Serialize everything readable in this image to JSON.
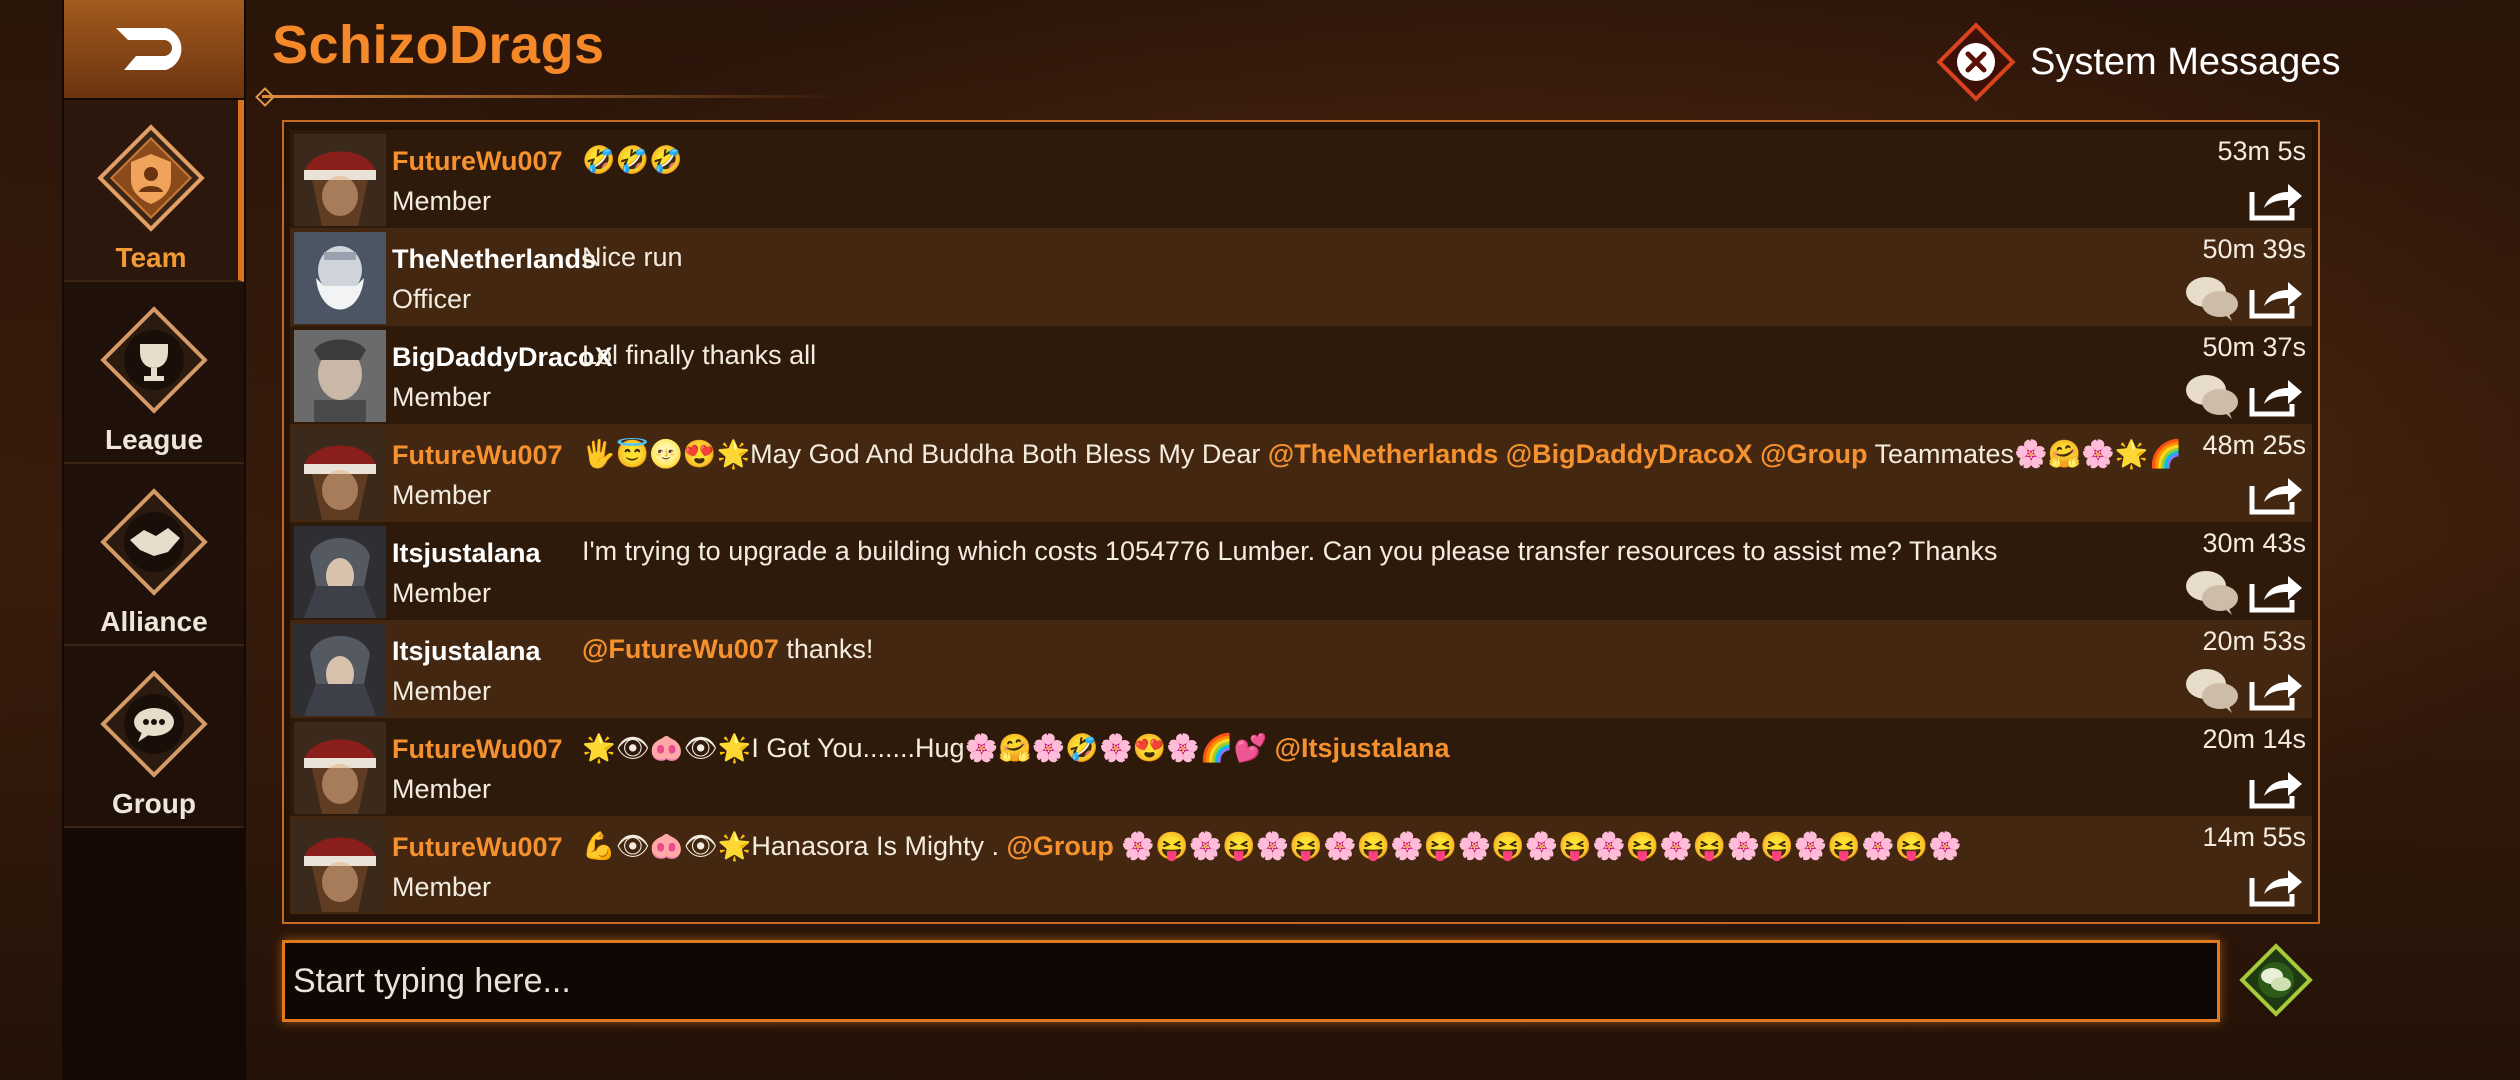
{
  "header": {
    "title": "SchizoDrags",
    "system_messages_label": "System Messages"
  },
  "sidebar": {
    "items": [
      {
        "label": "Team",
        "icon": "team-shield-icon",
        "active": true
      },
      {
        "label": "League",
        "icon": "trophy-icon",
        "active": false
      },
      {
        "label": "Alliance",
        "icon": "handshake-icon",
        "active": false
      },
      {
        "label": "Group",
        "icon": "group-chat-icon",
        "active": false
      }
    ]
  },
  "messages": [
    {
      "user": "FutureWu007",
      "role": "Member",
      "text": "🤣🤣🤣",
      "time": "53m 5s",
      "reply": false
    },
    {
      "user": "TheNetherlands",
      "role": "Officer",
      "text": "Nice run",
      "time": "50m 39s",
      "reply": true
    },
    {
      "user": "BigDaddyDracoX",
      "role": "Member",
      "text": "Lol finally thanks all",
      "time": "50m 37s",
      "reply": true
    },
    {
      "user": "FutureWu007",
      "role": "Member",
      "text_pre": "🖐😇🌝😍🌟May God And Buddha Both Bless My Dear ",
      "mentions": [
        "@TheNetherlands",
        "@BigDaddyDracoX",
        "@Group"
      ],
      "text_post": " Teammates🌸🤗🌸🌟🌈💕",
      "time": "48m 25s",
      "reply": false
    },
    {
      "user": "Itsjustalana",
      "role": "Member",
      "text": "I'm trying to upgrade a building which costs 1054776 Lumber. Can you please transfer resources to assist me? Thanks",
      "time": "30m 43s",
      "reply": true
    },
    {
      "user": "Itsjustalana",
      "role": "Member",
      "mention": "@FutureWu007",
      "text_post": " thanks!",
      "time": "20m 53s",
      "reply": true
    },
    {
      "user": "FutureWu007",
      "role": "Member",
      "text_pre": "🌟👁🐽👁🌟I Got You.......Hug🌸🤗🌸🤣🌸😍🌸🌈💕 ",
      "mention": "@Itsjustalana",
      "time": "20m 14s",
      "reply": false
    },
    {
      "user": "FutureWu007",
      "role": "Member",
      "text_pre": "💪👁🐽👁🌟Hanasora Is Mighty . ",
      "mention": "@Group",
      "text_post": " 🌸😝🌸😝🌸😝🌸😝🌸😝🌸😝🌸😝🌸😝🌸😝🌸😝🌸😝🌸😝🌸",
      "time": "14m 55s",
      "reply": false
    }
  ],
  "input": {
    "placeholder": "Start typing here..."
  },
  "colors": {
    "accent": "#f5892a",
    "username_member": "#f5922f",
    "username_other": "#ffffff"
  }
}
